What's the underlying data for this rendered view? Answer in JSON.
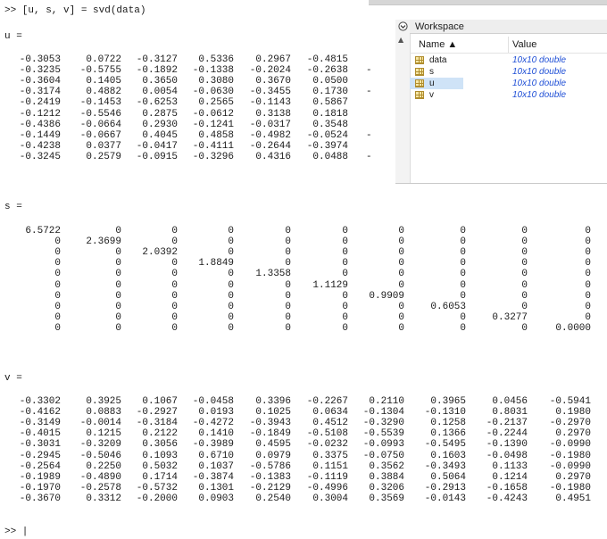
{
  "command": ">> [u, s, v] = svd(data)",
  "u_label": "u =",
  "s_label": "s =",
  "v_label": "v =",
  "prompt": ">> |",
  "u_matrix": [
    [
      "-0.3053",
      "0.0722",
      "-0.3127",
      "0.5336",
      "0.2967",
      "-0.4815"
    ],
    [
      "-0.3235",
      "-0.5755",
      "-0.1892",
      "-0.1338",
      "-0.2024",
      "-0.2638"
    ],
    [
      "-0.3604",
      "0.1405",
      "0.3650",
      "0.3080",
      "0.3670",
      "0.0500"
    ],
    [
      "-0.3174",
      "0.4882",
      "0.0054",
      "-0.0630",
      "-0.3455",
      "0.1730"
    ],
    [
      "-0.2419",
      "-0.1453",
      "-0.6253",
      "0.2565",
      "-0.1143",
      "0.5867"
    ],
    [
      "-0.1212",
      "-0.5546",
      "0.2875",
      "-0.0612",
      "0.3138",
      "0.1818"
    ],
    [
      "-0.4386",
      "-0.0664",
      "0.2930",
      "-0.1241",
      "-0.0317",
      "0.3548"
    ],
    [
      "-0.1449",
      "-0.0667",
      "0.4045",
      "0.4858",
      "-0.4982",
      "-0.0524"
    ],
    [
      "-0.4238",
      "0.0377",
      "-0.0417",
      "-0.4111",
      "-0.2644",
      "-0.3974"
    ],
    [
      "-0.3245",
      "0.2579",
      "-0.0915",
      "-0.3296",
      "0.4316",
      "0.0488"
    ]
  ],
  "u_dashes": [
    "",
    "-",
    "",
    "-",
    "",
    "",
    "",
    "-",
    "",
    "-"
  ],
  "s_matrix": [
    [
      "6.5722",
      "0",
      "0",
      "0",
      "0",
      "0",
      "0",
      "0",
      "0",
      "0"
    ],
    [
      "0",
      "2.3699",
      "0",
      "0",
      "0",
      "0",
      "0",
      "0",
      "0",
      "0"
    ],
    [
      "0",
      "0",
      "2.0392",
      "0",
      "0",
      "0",
      "0",
      "0",
      "0",
      "0"
    ],
    [
      "0",
      "0",
      "0",
      "1.8849",
      "0",
      "0",
      "0",
      "0",
      "0",
      "0"
    ],
    [
      "0",
      "0",
      "0",
      "0",
      "1.3358",
      "0",
      "0",
      "0",
      "0",
      "0"
    ],
    [
      "0",
      "0",
      "0",
      "0",
      "0",
      "1.1129",
      "0",
      "0",
      "0",
      "0"
    ],
    [
      "0",
      "0",
      "0",
      "0",
      "0",
      "0",
      "0.9909",
      "0",
      "0",
      "0"
    ],
    [
      "0",
      "0",
      "0",
      "0",
      "0",
      "0",
      "0",
      "0.6053",
      "0",
      "0"
    ],
    [
      "0",
      "0",
      "0",
      "0",
      "0",
      "0",
      "0",
      "0",
      "0.3277",
      "0"
    ],
    [
      "0",
      "0",
      "0",
      "0",
      "0",
      "0",
      "0",
      "0",
      "0",
      "0.0000"
    ]
  ],
  "v_matrix": [
    [
      "-0.3302",
      "0.3925",
      "0.1067",
      "-0.0458",
      "0.3396",
      "-0.2267",
      "0.2110",
      "0.3965",
      "0.0456",
      "-0.5941"
    ],
    [
      "-0.4162",
      "0.0883",
      "-0.2927",
      "0.0193",
      "0.1025",
      "0.0634",
      "-0.1304",
      "-0.1310",
      "0.8031",
      "0.1980"
    ],
    [
      "-0.3149",
      "-0.0014",
      "-0.3184",
      "-0.4272",
      "-0.3943",
      "0.4512",
      "-0.3290",
      "0.1258",
      "-0.2137",
      "-0.2970"
    ],
    [
      "-0.4015",
      "0.1215",
      "0.2122",
      "0.1410",
      "-0.1849",
      "-0.5108",
      "-0.5539",
      "0.1366",
      "-0.2244",
      "0.2970"
    ],
    [
      "-0.3031",
      "-0.3209",
      "0.3056",
      "-0.3989",
      "0.4595",
      "-0.0232",
      "-0.0993",
      "-0.5495",
      "-0.1390",
      "-0.0990"
    ],
    [
      "-0.2945",
      "-0.5046",
      "0.1093",
      "0.6710",
      "0.0979",
      "0.3375",
      "-0.0750",
      "0.1603",
      "-0.0498",
      "-0.1980"
    ],
    [
      "-0.2564",
      "0.2250",
      "0.5032",
      "0.1037",
      "-0.5786",
      "0.1151",
      "0.3562",
      "-0.3493",
      "0.1133",
      "-0.0990"
    ],
    [
      "-0.1989",
      "-0.4890",
      "0.1714",
      "-0.3874",
      "-0.1383",
      "-0.1119",
      "0.3884",
      "0.5064",
      "0.1214",
      "0.2970"
    ],
    [
      "-0.1970",
      "-0.2578",
      "-0.5732",
      "0.1301",
      "-0.2129",
      "-0.4996",
      "0.3206",
      "-0.2913",
      "-0.1658",
      "-0.1980"
    ],
    [
      "-0.3670",
      "0.3312",
      "-0.2000",
      "0.0903",
      "0.2540",
      "0.3004",
      "0.3569",
      "-0.0143",
      "-0.4243",
      "0.4951"
    ]
  ],
  "workspace": {
    "title": "Workspace",
    "col_name": "Name ▲",
    "col_value": "Value",
    "collapse_icon": "chevron-down-circle",
    "scroll_icon": "scroll-up-arrow",
    "variables": [
      {
        "name": "data",
        "value": "10x10 double",
        "selected": false
      },
      {
        "name": "s",
        "value": "10x10 double",
        "selected": false
      },
      {
        "name": "u",
        "value": "10x10 double",
        "selected": true
      },
      {
        "name": "v",
        "value": "10x10 double",
        "selected": false
      }
    ]
  },
  "colors": {
    "value_text": "#1f4fd6",
    "selection": "#cfe3f7"
  }
}
